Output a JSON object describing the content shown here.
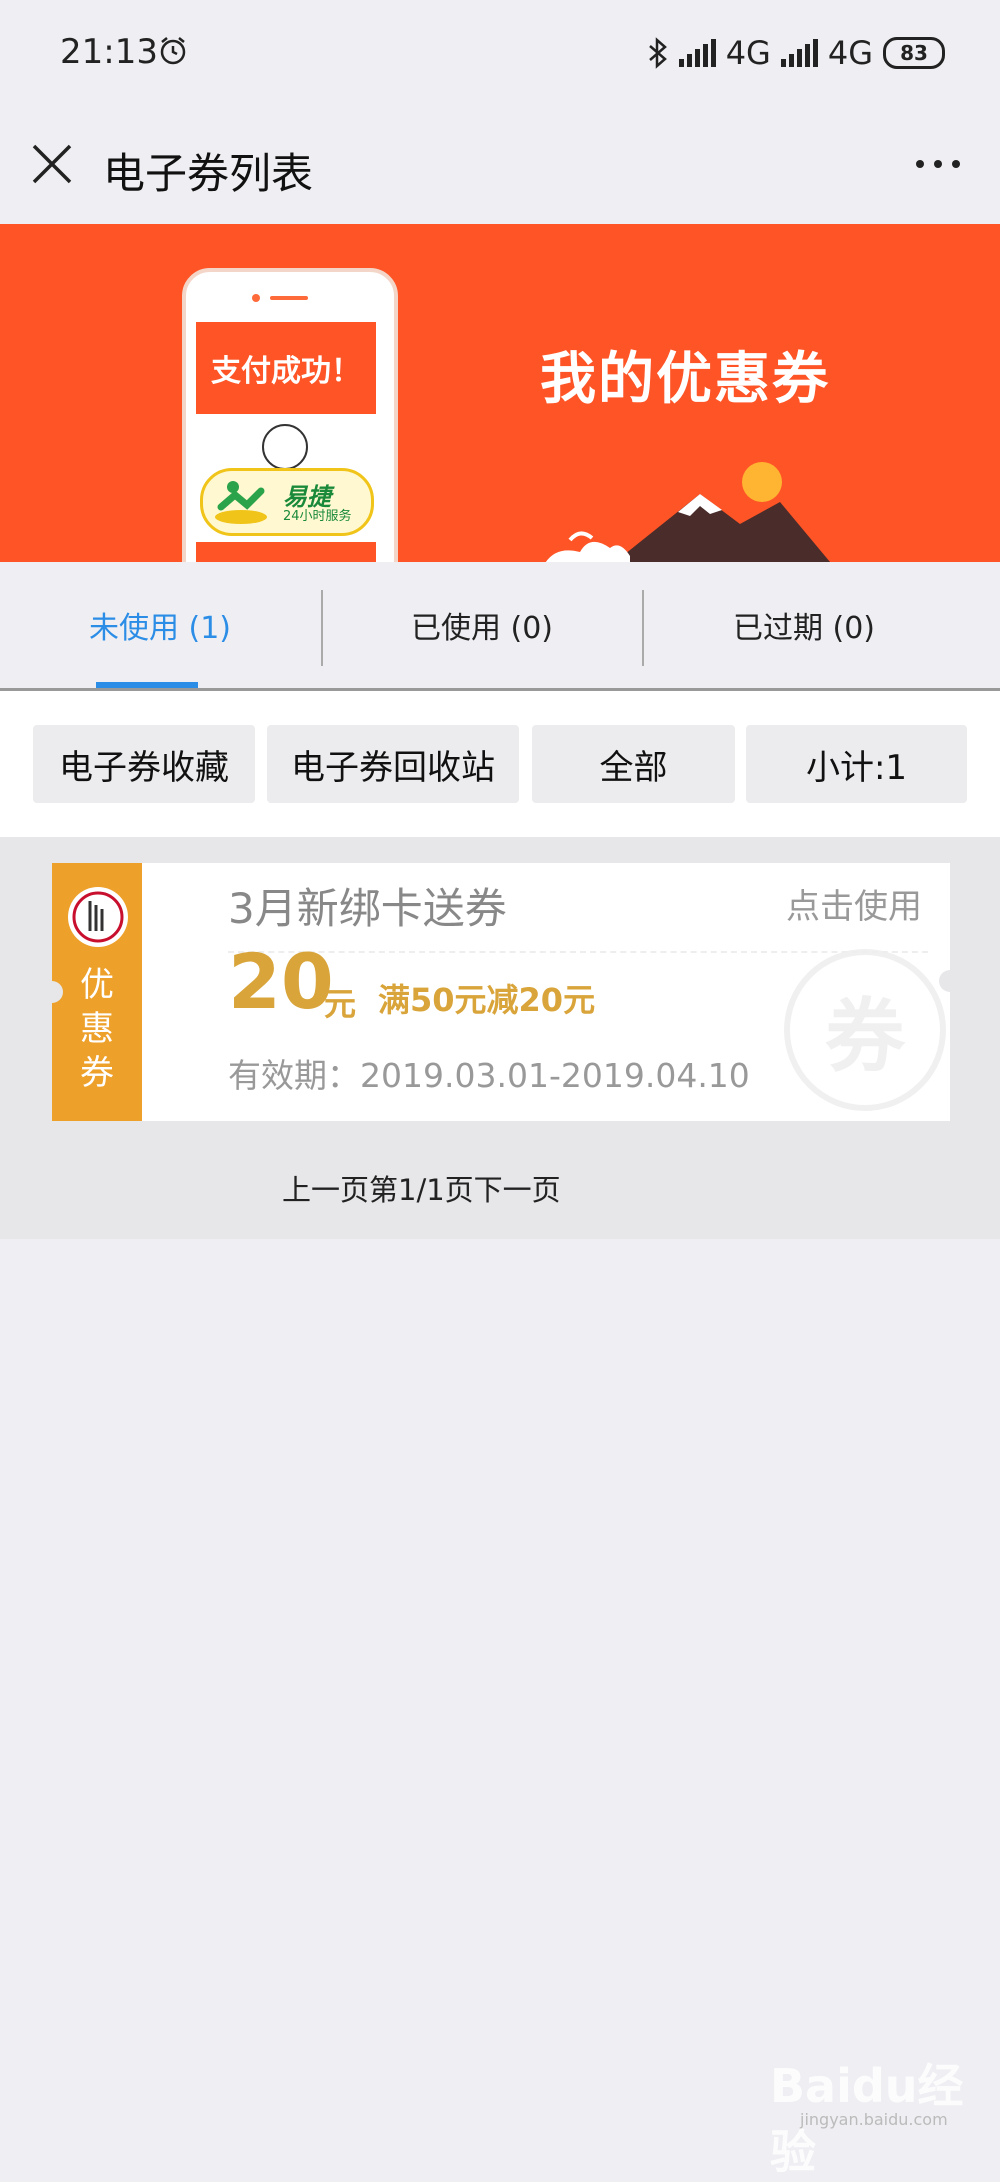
{
  "status_bar": {
    "time": "21:13",
    "network_1": "4G",
    "network_2": "4G",
    "battery": "83"
  },
  "nav": {
    "title": "电子券列表"
  },
  "banner": {
    "pay_text": "支付成功！",
    "brand_text": "易捷",
    "brand_sub": "24小时服务",
    "title": "我的优惠券",
    "accent": "#fe5426"
  },
  "tabs": [
    {
      "label": "未使用 (1)",
      "active": true
    },
    {
      "label": "已使用 (0)",
      "active": false
    },
    {
      "label": "已过期 (0)",
      "active": false
    }
  ],
  "filters": {
    "favorites": "电子券收藏",
    "recycle": "电子券回收站",
    "all": "全部",
    "subtotal": "小计:1"
  },
  "coupons": [
    {
      "side_label": "优惠券",
      "title": "3月新绑卡送券",
      "action": "点击使用",
      "amount": "20",
      "unit": "元",
      "rule": "满50元减20元",
      "validity": "有效期：2019.03.01-2019.04.10",
      "stamp": "券",
      "color": "#eda02a"
    }
  ],
  "pager": {
    "text": "上一页第1/1页下一页"
  },
  "watermark": {
    "text": "Baidu经验",
    "sub": "jingyan.baidu.com"
  }
}
